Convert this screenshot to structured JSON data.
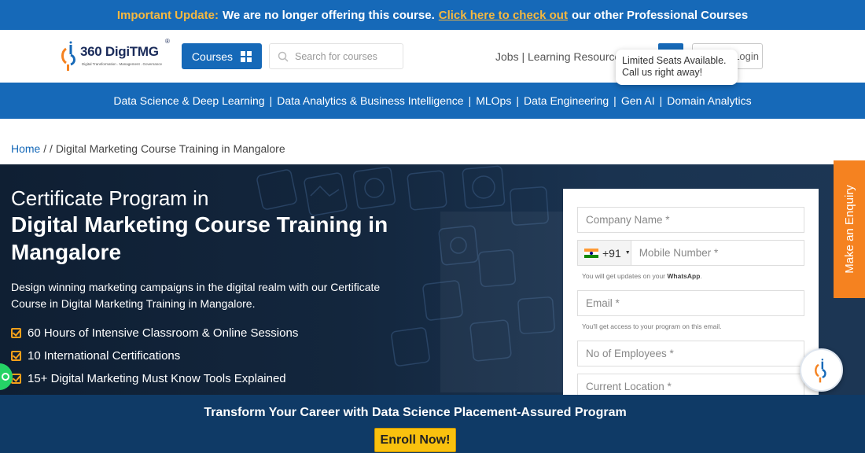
{
  "announcement": {
    "prefix": "Important Update:",
    "text": "We are no longer offering this course.",
    "link": "Click here to check out",
    "suffix": "our other Professional Courses"
  },
  "header": {
    "logo_name": "360 DigiTMG",
    "logo_reg": "®",
    "logo_tagline": "Digital Transformation . Management . Governance",
    "courses_label": "Courses",
    "search_placeholder": "Search for courses",
    "jobs_label": "Jobs",
    "link_separator": "|",
    "learning_label": "Learning Resources",
    "login_label": "Login",
    "tooltip_line1": "Limited Seats Available.",
    "tooltip_line2": "Call us right away!"
  },
  "nav": {
    "separator": "|",
    "items": [
      "Data Science & Deep Learning",
      "Data Analytics & Business Intelligence",
      "MLOps",
      "Data Engineering",
      "Gen AI",
      "Domain Analytics"
    ]
  },
  "breadcrumb": {
    "home": "Home",
    "separator": "/ /",
    "current": "Digital Marketing Course Training in Mangalore"
  },
  "hero": {
    "subtitle": "Certificate Program in",
    "title": "Digital Marketing Course Training in Mangalore",
    "description": "Design winning marketing campaigns in the digital realm with our Certificate Course in Digital Marketing Training in Mangalore.",
    "features": [
      "60 Hours of Intensive Classroom & Online Sessions",
      "10 International Certifications",
      "15+ Digital Marketing Must Know Tools Explained"
    ]
  },
  "form": {
    "company_placeholder": "Company Name *",
    "country_code": "+91",
    "mobile_placeholder": "Mobile Number *",
    "mobile_hint_prefix": "You will get updates on your",
    "mobile_hint_bold": "WhatsApp",
    "mobile_hint_suffix": ".",
    "email_placeholder": "Email *",
    "email_hint": "You'll get access to your program on this email.",
    "employees_placeholder": "No of Employees *",
    "location_placeholder": "Current Location *"
  },
  "enquiry_label": "Make an Enquiry",
  "banner": {
    "title": "Transform Your Career with Data Science Placement-Assured Program",
    "button": "Enroll Now!"
  },
  "colors": {
    "primary_blue": "#1669b8",
    "accent_orange": "#f58220",
    "highlight_gold": "#f5b840",
    "enroll_yellow": "#f9c10e",
    "banner_navy": "#0f3a66"
  }
}
